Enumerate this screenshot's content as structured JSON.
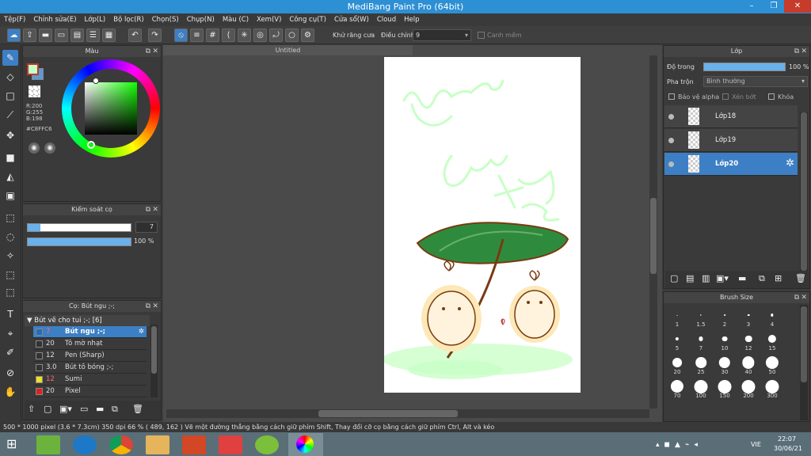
{
  "window": {
    "title": "MediBang Paint Pro (64bit)",
    "minimize": "–",
    "restore": "❐",
    "close": "✕"
  },
  "menu": [
    "Tệp(F)",
    "Chỉnh sửa(E)",
    "Lớp(L)",
    "Bộ lọc(R)",
    "Chọn(S)",
    "Chụp(N)",
    "Màu (C)",
    "Xem(V)",
    "Công cụ(T)",
    "Cửa sổ(W)",
    "Cloud",
    "Help"
  ],
  "toolbar": {
    "antialias_label": "Khử răng cưa",
    "correction_label": "Điều chỉnh",
    "correction_value": "9",
    "smooth_label": "Canh mềm"
  },
  "color_panel": {
    "title": "Màu",
    "r": "R:200",
    "g": "G:255",
    "b": "B:198",
    "hex": "#C8FFC6",
    "current": "#c8ffc6"
  },
  "brush_control": {
    "title": "Kiểm soát cọ",
    "size": "7",
    "opacity": "100 %"
  },
  "brush_panel": {
    "title": "Cọ: Bút ngu ;-;",
    "group": "Bút vẽ cho tui ;-; [6]",
    "brushes": [
      {
        "size": "7",
        "name": "Bút ngu ;-;",
        "color": "#1f6ec0"
      },
      {
        "size": "20",
        "name": "Tô mờ nhạt",
        "color": "#333333"
      },
      {
        "size": "12",
        "name": "Pen (Sharp)",
        "color": "#333333"
      },
      {
        "size": "3.0",
        "name": "Bút tô bóng ;-;",
        "color": "#333333"
      },
      {
        "size": "12",
        "name": "Sumi",
        "color": "#f0e020"
      },
      {
        "size": "20",
        "name": "Pixel",
        "color": "#e02020"
      }
    ]
  },
  "canvas": {
    "tab": "Untitled"
  },
  "layer_panel": {
    "title": "Lớp",
    "opacity_label": "Độ trong",
    "opacity_value": "100 %",
    "blend_label": "Pha trộn",
    "blend_value": "Bình thường",
    "protect_alpha": "Bảo vệ alpha",
    "clipping": "Xén bớt",
    "lock": "Khóa",
    "layers": [
      {
        "name": "Lớp18",
        "selected": false
      },
      {
        "name": "Lớp19",
        "selected": false
      },
      {
        "name": "Lớp20",
        "selected": true
      }
    ]
  },
  "brush_size_panel": {
    "title": "Brush Size",
    "sizes": [
      "1",
      "1.5",
      "2",
      "3",
      "4",
      "5",
      "7",
      "10",
      "12",
      "15",
      "20",
      "25",
      "30",
      "40",
      "50",
      "70",
      "100",
      "150",
      "200",
      "300"
    ]
  },
  "status": {
    "text": "500 * 1000 pixel   (3.6 * 7.3cm)   350 dpi   66 %   ( 489, 162 )   Vẽ một đường thẳng bằng cách giữ phím Shift, Thay đổi cỡ cọ bằng cách giữ phím Ctrl, Alt và kéo"
  },
  "taskbar": {
    "lang": "VIE",
    "time": "22:07",
    "date": "30/06/21"
  }
}
